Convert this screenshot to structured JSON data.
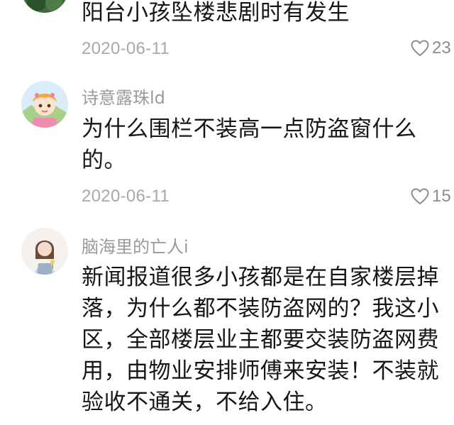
{
  "comments": [
    {
      "text": "阳台小孩坠楼悲剧时有发生",
      "date": "2020-06-11",
      "likes": "23"
    },
    {
      "username": "诗意露珠ld",
      "text": "为什么围栏不装高一点防盗窗什么的。",
      "date": "2020-06-11",
      "likes": "15"
    },
    {
      "username": "脑海里的亡人i",
      "text": "新闻报道很多小孩都是在自家楼层掉落，为什么都不装防盗网的？我这小区，全部楼层业主都要交装防盗网费用，由物业安排师傅来安装！不装就验收不通关，不给入住。"
    }
  ],
  "icons": {
    "like": "heart-outline-icon"
  },
  "colors": {
    "username": "#9a9a9a",
    "date": "#a8a8a8",
    "text": "#161616",
    "icon": "#8d8d8d"
  }
}
